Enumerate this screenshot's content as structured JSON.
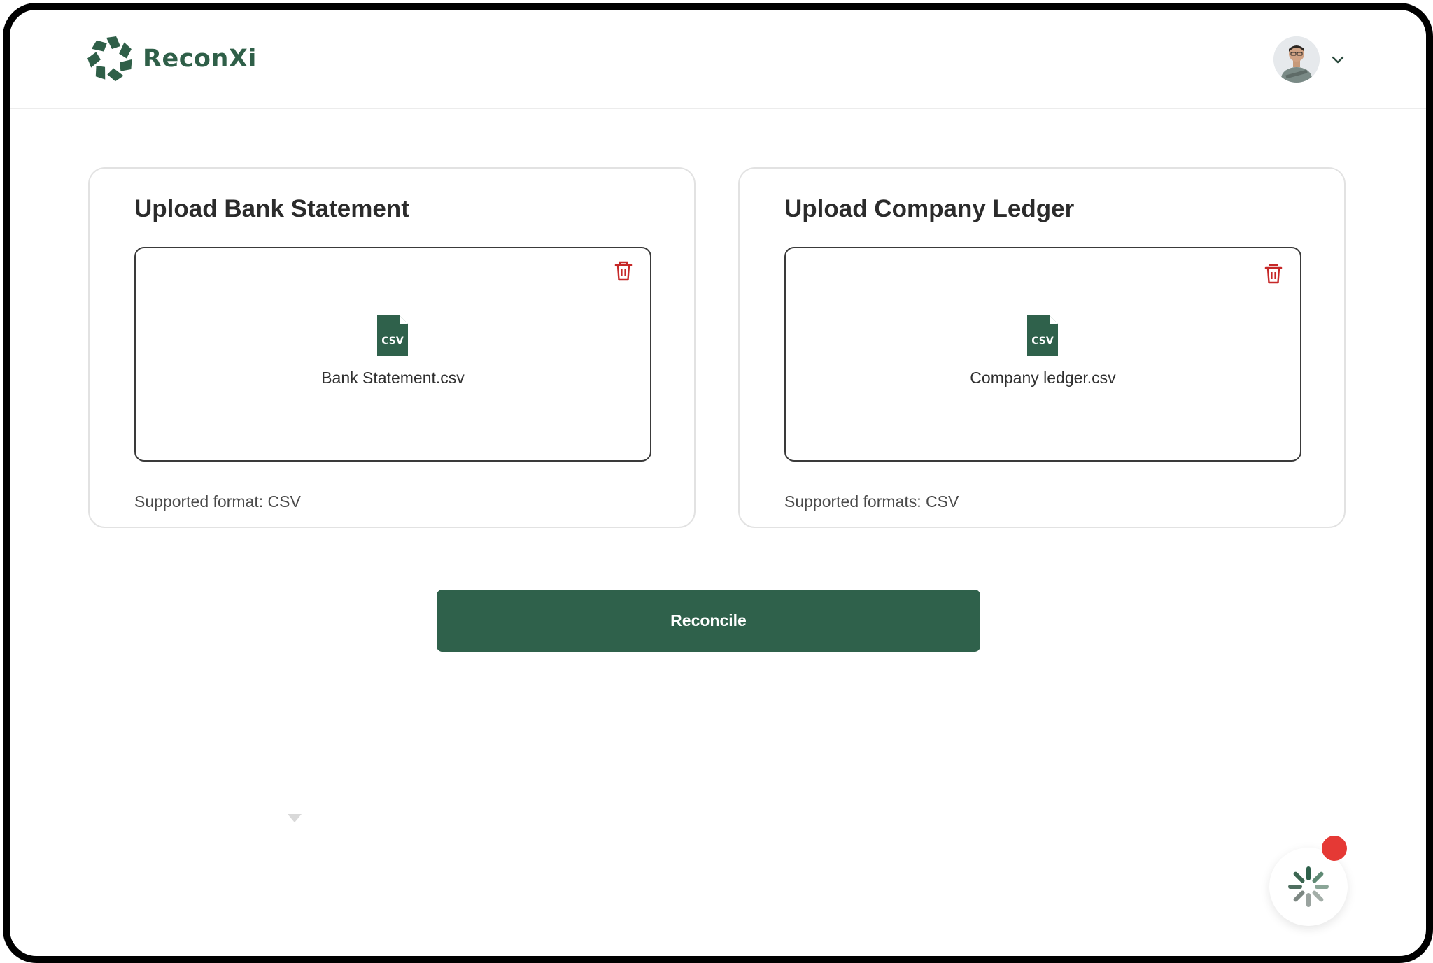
{
  "app": {
    "name": "ReconXi",
    "brand_color": "#2f614b",
    "danger_color": "#d32f2f"
  },
  "header": {
    "logo_icon": "reconxi-logo-icon",
    "avatar_icon": "user-avatar",
    "dropdown_icon": "chevron-down-icon"
  },
  "bank_card": {
    "title": "Upload Bank Statement",
    "file_name": "Bank Statement.csv",
    "file_icon": "csv-file-icon",
    "delete_icon": "trash-icon",
    "format_note": "Supported format: CSV"
  },
  "ledger_card": {
    "title": "Upload Company Ledger",
    "file_name": "Company ledger.csv",
    "file_icon": "csv-file-icon",
    "delete_icon": "trash-icon",
    "format_note": "Supported formats: CSV"
  },
  "actions": {
    "reconcile_label": "Reconcile"
  },
  "assistant": {
    "icon": "spinner-icon",
    "has_notification": true
  }
}
